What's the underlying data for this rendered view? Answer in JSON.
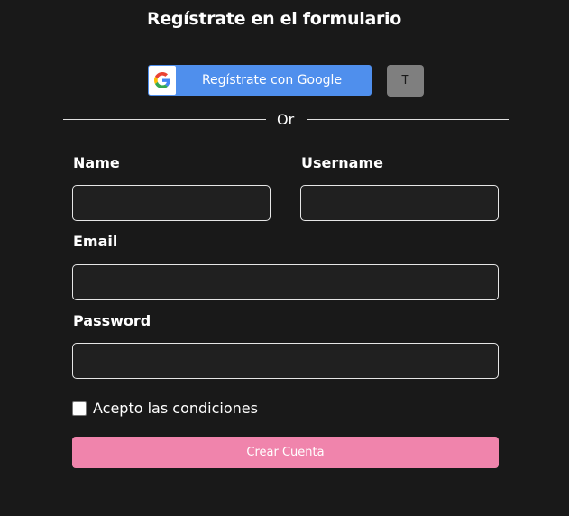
{
  "header": {
    "title": "Regístrate en el formulario"
  },
  "social": {
    "google_label": "Regístrate con Google",
    "google_icon": "google-logo-icon",
    "secondary_button_label": "T"
  },
  "divider": {
    "text": "Or"
  },
  "form": {
    "name_label": "Name",
    "name_value": "",
    "username_label": "Username",
    "username_value": "",
    "email_label": "Email",
    "email_value": "",
    "password_label": "Password",
    "password_value": "",
    "terms_label": "Acepto las condiciones",
    "terms_checked": false,
    "submit_label": "Crear Cuenta"
  },
  "colors": {
    "background": "#191919",
    "google_button": "#4f8fed",
    "submit_button": "#f084ac",
    "secondary_button": "#7f7f7f",
    "field_background": "#202020"
  }
}
